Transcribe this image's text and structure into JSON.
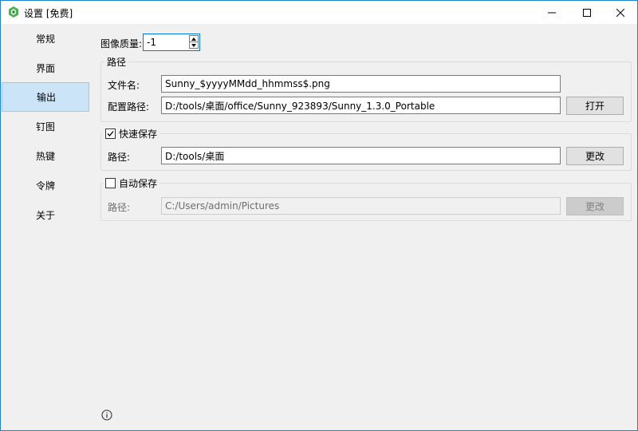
{
  "window": {
    "title": "设置 [免费]"
  },
  "sidebar": {
    "items": [
      {
        "label": "常规"
      },
      {
        "label": "界面"
      },
      {
        "label": "输出"
      },
      {
        "label": "钉图"
      },
      {
        "label": "热键"
      },
      {
        "label": "令牌"
      },
      {
        "label": "关于"
      }
    ],
    "active_index": 2
  },
  "output": {
    "image_quality_label": "图像质量:",
    "image_quality_value": "-1",
    "path_group": {
      "title": "路径",
      "filename_label": "文件名:",
      "filename_value": "Sunny_$yyyyMMdd_hhmmss$.png",
      "config_path_label": "配置路径:",
      "config_path_value": "D:/tools/桌面/office/Sunny_923893/Sunny_1.3.0_Portable",
      "open_button": "打开"
    },
    "quick_save": {
      "title": "快速保存",
      "checked": true,
      "path_label": "路径:",
      "path_value": "D:/tools/桌面",
      "change_button": "更改"
    },
    "auto_save": {
      "title": "自动保存",
      "checked": false,
      "path_label": "路径:",
      "path_value": "C:/Users/admin/Pictures",
      "change_button": "更改"
    }
  },
  "colors": {
    "accent": "#0078d7",
    "active_item_bg": "#cce4f7",
    "window_border": "#1883d7"
  },
  "icons": {
    "app": "green-hexagon-app-icon",
    "info": "info-icon"
  }
}
